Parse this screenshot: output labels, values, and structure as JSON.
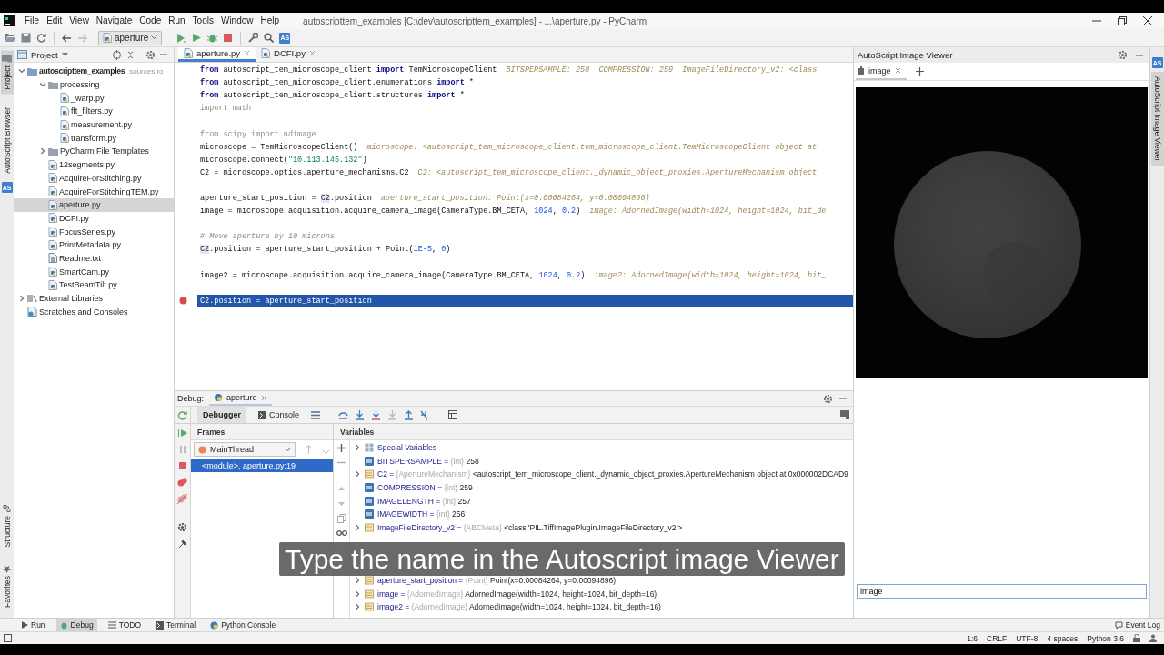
{
  "menu_bar": {
    "items": [
      "File",
      "Edit",
      "View",
      "Navigate",
      "Code",
      "Run",
      "Tools",
      "Window",
      "Help"
    ],
    "title": "autoscripttem_examples [C:\\dev\\autoscripttem_examples] - ...\\aperture.py - PyCharm"
  },
  "toolbar": {
    "run_configuration": "aperture",
    "badge": "AS"
  },
  "left_strip": {
    "tabs": [
      {
        "label": "Project",
        "selected": true
      },
      {
        "label": "AutoScript Browser",
        "selected": false
      }
    ],
    "badge": "AS",
    "bottom_tabs": [
      {
        "label": "Structure",
        "selected": false
      },
      {
        "label": "Favorites",
        "selected": false
      }
    ]
  },
  "project_panel": {
    "title": "Project",
    "tree": [
      {
        "label": "autoscripttem_examples",
        "note": "sources ro",
        "kind": "root",
        "expanded": true,
        "selected": false,
        "children": [
          {
            "label": "processing",
            "kind": "folder",
            "expanded": true,
            "selected": false,
            "children": [
              {
                "label": "_warp.py",
                "kind": "python",
                "selected": false
              },
              {
                "label": "fft_filters.py",
                "kind": "python",
                "selected": false
              },
              {
                "label": "measurement.py",
                "kind": "python",
                "selected": false
              },
              {
                "label": "transform.py",
                "kind": "python",
                "selected": false
              }
            ]
          },
          {
            "label": "PyCharm File Templates",
            "kind": "folder",
            "expanded": false,
            "selected": false
          },
          {
            "label": "12segments.py",
            "kind": "python",
            "selected": false
          },
          {
            "label": "AcquireForStitching.py",
            "kind": "python",
            "selected": false
          },
          {
            "label": "AcquireForStitchingTEM.py",
            "kind": "python",
            "selected": false
          },
          {
            "label": "aperture.py",
            "kind": "python",
            "selected": true
          },
          {
            "label": "DCFI.py",
            "kind": "python",
            "selected": false
          },
          {
            "label": "FocusSeries.py",
            "kind": "python",
            "selected": false
          },
          {
            "label": "PrintMetadata.py",
            "kind": "python",
            "selected": false
          },
          {
            "label": "Readme.txt",
            "kind": "text",
            "selected": false
          },
          {
            "label": "SmartCam.py",
            "kind": "python",
            "selected": false
          },
          {
            "label": "TestBeamTilt.py",
            "kind": "python",
            "selected": false
          }
        ]
      },
      {
        "label": "External Libraries",
        "kind": "library",
        "expanded": false,
        "selected": false
      },
      {
        "label": "Scratches and Consoles",
        "kind": "scratches",
        "selected": false
      }
    ]
  },
  "editor": {
    "tabs": [
      {
        "label": "aperture.py",
        "selected": true
      },
      {
        "label": "DCFI.py",
        "selected": false
      }
    ],
    "lines": [
      {
        "current": false,
        "breakpoint": false,
        "segments": [
          {
            "kind": "kw",
            "text": "from"
          },
          {
            "kind": "plain",
            "text": " autoscript_tem_microscope_client "
          },
          {
            "kind": "kw",
            "text": "import"
          },
          {
            "kind": "plain",
            "text": " TemMicroscopeClient"
          },
          {
            "kind": "hint",
            "text": "BITSPERSAMPLE: 258  COMPRESSION: 259  ImageFileDirectory_v2: <class"
          }
        ]
      },
      {
        "current": false,
        "breakpoint": false,
        "segments": [
          {
            "kind": "kw",
            "text": "from"
          },
          {
            "kind": "plain",
            "text": " autoscript_tem_microscope_client.enumerations "
          },
          {
            "kind": "kw",
            "text": "import"
          },
          {
            "kind": "plain",
            "text": " *"
          }
        ]
      },
      {
        "current": false,
        "breakpoint": false,
        "segments": [
          {
            "kind": "kw",
            "text": "from"
          },
          {
            "kind": "plain",
            "text": " autoscript_tem_microscope_client.structures "
          },
          {
            "kind": "kw",
            "text": "import"
          },
          {
            "kind": "plain",
            "text": " *"
          }
        ]
      },
      {
        "current": false,
        "breakpoint": false,
        "segments": [
          {
            "kind": "unused",
            "text": "import math"
          }
        ]
      },
      {
        "current": false,
        "breakpoint": false
      },
      {
        "current": false,
        "breakpoint": false,
        "segments": [
          {
            "kind": "unused",
            "text": "from scipy import ndimage"
          }
        ]
      },
      {
        "current": false,
        "breakpoint": false,
        "segments": [
          {
            "kind": "plain",
            "text": "microscope = TemMicroscopeClient()"
          },
          {
            "kind": "hint",
            "text": "microscope: <autoscript_tem_microscope_client.tem_microscope_client.TemMicroscopeClient object at"
          }
        ]
      },
      {
        "current": false,
        "breakpoint": false,
        "segments": [
          {
            "kind": "plain",
            "text": "microscope.connect("
          },
          {
            "kind": "str",
            "text": "\"10.113.145.132\""
          },
          {
            "kind": "plain",
            "text": ")"
          }
        ]
      },
      {
        "current": false,
        "breakpoint": false,
        "segments": [
          {
            "kind": "plain",
            "text": "C2 = microscope.optics.aperture_mechanisms.C2"
          },
          {
            "kind": "hint",
            "text": "C2: <autoscript_tem_microscope_client._dynamic_object_proxies.ApertureMechanism object"
          }
        ]
      },
      {
        "current": false,
        "breakpoint": false
      },
      {
        "current": false,
        "breakpoint": false,
        "segments": [
          {
            "kind": "plain",
            "text": "aperture_start_position = "
          },
          {
            "kind": "mark",
            "text": "C2"
          },
          {
            "kind": "plain",
            "text": ".position"
          },
          {
            "kind": "hint",
            "text": "aperture_start_position: Point(x=0.00084264, y=0.00094896)"
          }
        ]
      },
      {
        "current": false,
        "breakpoint": false,
        "segments": [
          {
            "kind": "plain",
            "text": "image = microscope.acquisition.acquire_camera_image(CameraType.BM_CETA, "
          },
          {
            "kind": "num",
            "text": "1024"
          },
          {
            "kind": "plain",
            "text": ", "
          },
          {
            "kind": "num",
            "text": "0.2"
          },
          {
            "kind": "plain",
            "text": ")"
          },
          {
            "kind": "hint",
            "text": "image: AdornedImage(width=1024, height=1024, bit_de"
          }
        ]
      },
      {
        "current": false,
        "breakpoint": false
      },
      {
        "current": false,
        "breakpoint": false,
        "segments": [
          {
            "kind": "comment",
            "text": "# Move aperture by 10 microns"
          }
        ]
      },
      {
        "current": false,
        "breakpoint": false,
        "segments": [
          {
            "kind": "mark",
            "text": "C2"
          },
          {
            "kind": "plain",
            "text": ".position = aperture_start_position + Point("
          },
          {
            "kind": "num",
            "text": "1E-5"
          },
          {
            "kind": "plain",
            "text": ", "
          },
          {
            "kind": "num",
            "text": "0"
          },
          {
            "kind": "plain",
            "text": ")"
          }
        ]
      },
      {
        "current": false,
        "breakpoint": false
      },
      {
        "current": false,
        "breakpoint": false,
        "segments": [
          {
            "kind": "plain",
            "text": "image2 = microscope.acquisition.acquire_camera_image(CameraType.BM_CETA, "
          },
          {
            "kind": "num",
            "text": "1024"
          },
          {
            "kind": "plain",
            "text": ", "
          },
          {
            "kind": "num",
            "text": "0.2"
          },
          {
            "kind": "plain",
            "text": ")"
          },
          {
            "kind": "hint",
            "text": "image2: AdornedImage(width=1024, height=1024, bit_"
          }
        ]
      },
      {
        "current": false,
        "breakpoint": false
      },
      {
        "current": true,
        "breakpoint": true,
        "segments": [
          {
            "kind": "plain",
            "text": "C2.position = aperture_start_position"
          }
        ]
      }
    ]
  },
  "debug": {
    "label": "Debug:",
    "session_tab": "aperture",
    "view_tabs": [
      {
        "label": "Debugger",
        "selected": true
      },
      {
        "label": "Console",
        "selected": false
      }
    ],
    "frames": {
      "title": "Frames",
      "thread": "MainThread",
      "items": [
        {
          "label": "<module>, aperture.py:19",
          "selected": true
        }
      ]
    },
    "variables": {
      "title": "Variables",
      "rows": [
        {
          "kind": "group",
          "expandable": true,
          "name": "Special Variables"
        },
        {
          "kind": "int",
          "expandable": false,
          "name": "BITSPERSAMPLE",
          "separator": "=",
          "type": "{int}",
          "value": "258"
        },
        {
          "kind": "object",
          "expandable": true,
          "name": "C2",
          "separator": "=",
          "type": "{ApertureMechanism}",
          "value": "<autoscript_tem_microscope_client._dynamic_object_proxies.ApertureMechanism object at 0x000002DCAD9"
        },
        {
          "kind": "int",
          "expandable": false,
          "name": "COMPRESSION",
          "separator": "=",
          "type": "{int}",
          "value": "259"
        },
        {
          "kind": "int",
          "expandable": false,
          "name": "IMAGELENGTH",
          "separator": "=",
          "type": "{int}",
          "value": "257"
        },
        {
          "kind": "int",
          "expandable": false,
          "name": "IMAGEWIDTH",
          "separator": "=",
          "type": "{int}",
          "value": "256"
        },
        {
          "kind": "object",
          "expandable": true,
          "name": "ImageFileDirectory_v2",
          "separator": "=",
          "type": "{ABCMeta}",
          "value": "<class 'PIL.TiffImagePlugin.ImageFileDirectory_v2'>"
        },
        {
          "kind": "covered"
        },
        {
          "kind": "covered"
        },
        {
          "kind": "covered"
        },
        {
          "kind": "object",
          "expandable": true,
          "name": "aperture_start_position",
          "separator": "=",
          "type": "{Point}",
          "value": "Point(x=0.00084264, y=0.00094896)"
        },
        {
          "kind": "object",
          "expandable": true,
          "name": "image",
          "separator": "=",
          "type": "{AdornedImage}",
          "value": "AdornedImage(width=1024, height=1024, bit_depth=16)"
        },
        {
          "kind": "object",
          "expandable": true,
          "name": "image2",
          "separator": "=",
          "type": "{AdornedImage}",
          "value": "AdornedImage(width=1024, height=1024, bit_depth=16)"
        }
      ]
    }
  },
  "image_viewer": {
    "title": "AutoScript Image Viewer",
    "tabs": [
      {
        "label": "image",
        "selected": true
      }
    ],
    "name_field": {
      "value": "image"
    }
  },
  "right_strip": {
    "badge": "AS",
    "tabs": [
      {
        "label": "AutoScript Image Viewer",
        "selected": true
      }
    ]
  },
  "tool_window_bar": {
    "items": [
      {
        "label": "Run",
        "selected": false
      },
      {
        "label": "Debug",
        "selected": true
      },
      {
        "label": "TODO",
        "selected": false
      },
      {
        "label": "Terminal",
        "selected": false
      },
      {
        "label": "Python Console",
        "selected": false
      }
    ],
    "event_log": "Event Log"
  },
  "status_bar": {
    "items": [
      "1:6",
      "CRLF",
      "UTF-8",
      "4 spaces",
      "Python 3.6"
    ]
  },
  "caption": "Type the name in the Autoscript image Viewer"
}
